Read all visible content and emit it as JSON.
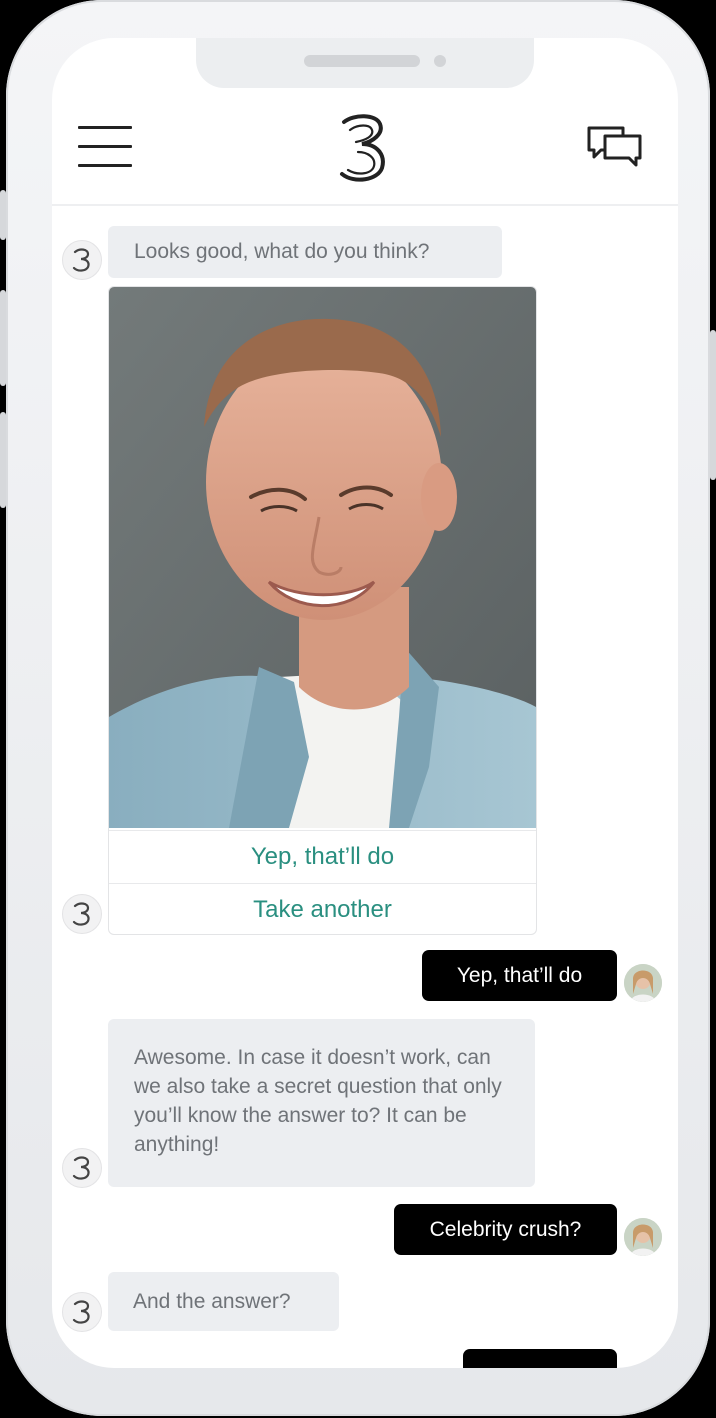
{
  "header": {
    "menu_icon": "hamburger-menu-icon",
    "logo_icon": "three-logo-icon",
    "chat_icon": "chat-bubbles-icon"
  },
  "messages": {
    "m1": "Looks good, what do you think?",
    "photo_icon": "selfie-photo",
    "option_1": "Yep, that’ll do",
    "option_2": "Take another",
    "m2": "Yep, that’ll do",
    "m3": "Awesome. In case it doesn’t work, can we also take a secret question that only you’ll know the answer to? It can be anything!",
    "m4": "Celebrity crush?",
    "m5": "And the answer?"
  },
  "colors": {
    "accent": "#2a8f80",
    "bot_bubble": "#eceef1",
    "user_bubble": "#000000"
  }
}
